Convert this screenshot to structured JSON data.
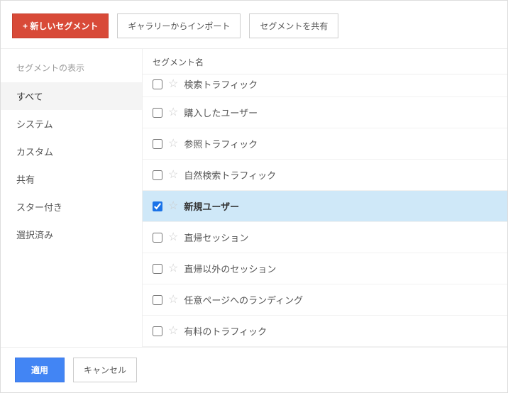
{
  "toolbar": {
    "new_segment": "+ 新しいセグメント",
    "import_gallery": "ギャラリーからインポート",
    "share_segment": "セグメントを共有"
  },
  "sidebar": {
    "title": "セグメントの表示",
    "items": [
      {
        "label": "すべて",
        "active": true
      },
      {
        "label": "システム",
        "active": false
      },
      {
        "label": "カスタム",
        "active": false
      },
      {
        "label": "共有",
        "active": false
      },
      {
        "label": "スター付き",
        "active": false
      },
      {
        "label": "選択済み",
        "active": false
      }
    ]
  },
  "main": {
    "header": "セグメント名",
    "rows": [
      {
        "label": "検索トラフィック",
        "checked": false,
        "partial": true
      },
      {
        "label": "購入したユーザー",
        "checked": false,
        "partial": false
      },
      {
        "label": "参照トラフィック",
        "checked": false,
        "partial": false
      },
      {
        "label": "自然検索トラフィック",
        "checked": false,
        "partial": false
      },
      {
        "label": "新規ユーザー",
        "checked": true,
        "partial": false
      },
      {
        "label": "直帰セッション",
        "checked": false,
        "partial": false
      },
      {
        "label": "直帰以外のセッション",
        "checked": false,
        "partial": false
      },
      {
        "label": "任意ページへのランディング",
        "checked": false,
        "partial": false
      },
      {
        "label": "有料のトラフィック",
        "checked": false,
        "partial": false
      }
    ]
  },
  "footer": {
    "apply": "適用",
    "cancel": "キャンセル"
  }
}
